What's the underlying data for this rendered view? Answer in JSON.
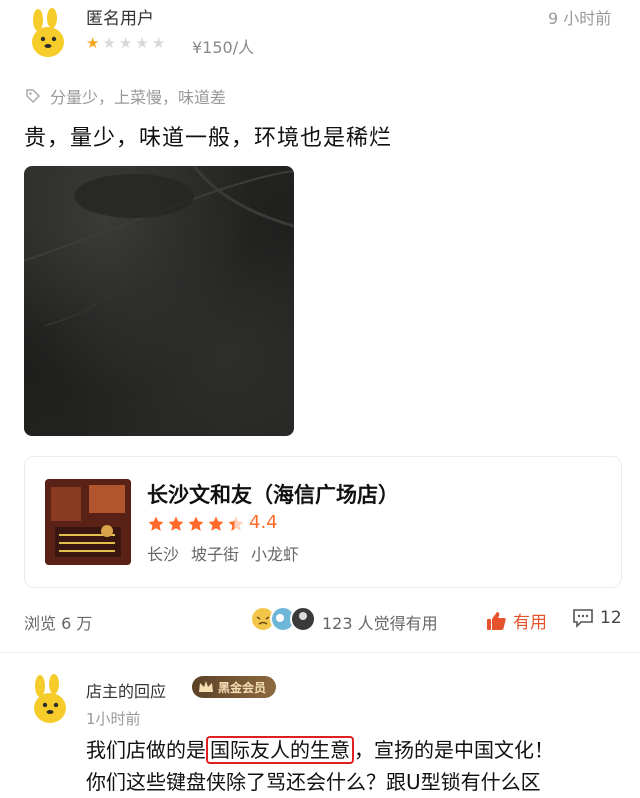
{
  "review": {
    "user_name": "匿名用户",
    "time": "9 小时前",
    "star_rating": 1,
    "star_max": 5,
    "price": "¥150/人",
    "tags": "分量少，上菜慢，味道差",
    "text": "贵，量少，味道一般，环境也是稀烂"
  },
  "shop": {
    "name": "长沙文和友（海信广场店）",
    "rating": "4.4",
    "rating_value": 4.4,
    "city": "长沙",
    "area": "坡子街",
    "category": "小龙虾"
  },
  "footer": {
    "views": "浏览 6 万",
    "useful_count": "123 人觉得有用",
    "useful_label": "有用",
    "comment_count": "12"
  },
  "reply": {
    "name": "店主的回应",
    "badge": "黑金会员",
    "time": "1小时前",
    "line1_pre": "我们店做的是",
    "line1_highlight": "国际友人的生意",
    "line1_post": "，宣扬的是中国文化！",
    "line2": "你们这些键盘侠除了骂还会什么？跟U型锁有什么区"
  },
  "colors": {
    "star_on": "#f5a623",
    "star_off": "#d8d8d8",
    "accent": "#ff6a2a",
    "useful": "#e5532c",
    "highlight_border": "#e02020"
  }
}
